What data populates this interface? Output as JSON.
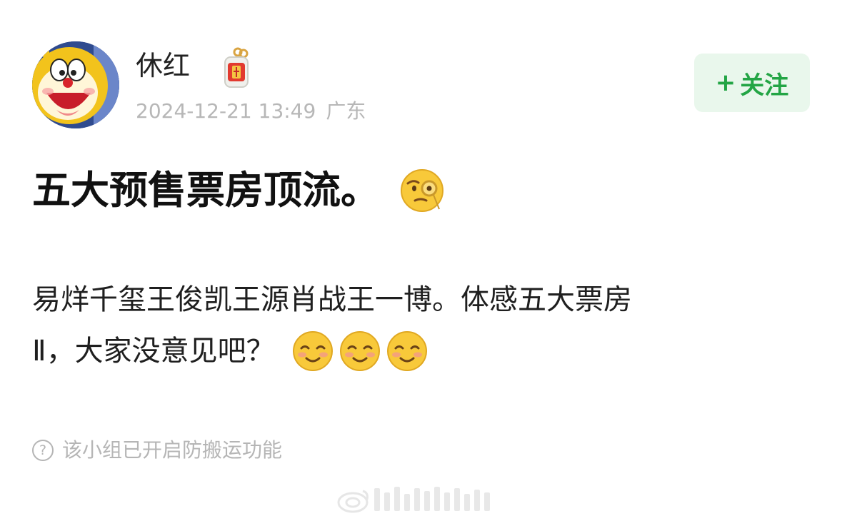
{
  "post": {
    "author": {
      "name": "休红",
      "avatar_icon": "doraemon-avatar",
      "badge_icon": "lucky-charm-icon"
    },
    "timestamp": "2024-12-21 13:49",
    "location": "广东",
    "follow_button": {
      "plus": "+",
      "label": "关注"
    },
    "title": "五大预售票房顶流。",
    "title_emoji": "face-with-monocle-emoji",
    "body_line1": "易烊千玺王俊凯王源肖战王一博。体感五大票房",
    "body_line2": "Ⅱ，大家没意见吧？",
    "body_emojis": [
      "smiling-face-emoji",
      "smiling-face-emoji",
      "smiling-face-emoji"
    ],
    "notice": {
      "icon": "question-circle-icon",
      "text": "该小组已开启防搬运功能"
    }
  },
  "colors": {
    "accent_green": "#23a545",
    "follow_bg": "#e9f7ec",
    "meta_gray": "#b7b7b7"
  }
}
